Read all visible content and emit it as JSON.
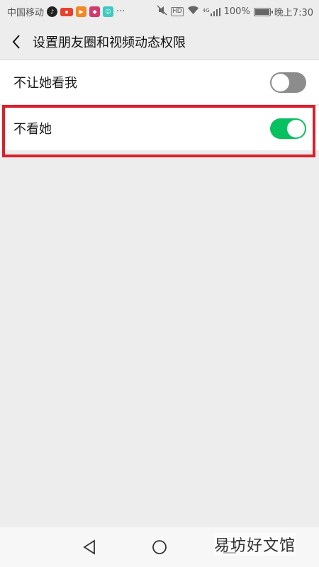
{
  "status_bar": {
    "carrier": "中国移动",
    "icons": [
      "tiktok-icon",
      "app-badge-icon",
      "video-app-icon",
      "app-icon",
      "app-icon",
      "more-dots-icon"
    ],
    "more": "···",
    "right_icons": [
      "mute-icon",
      "hd-icon",
      "wifi-icon",
      "signal-icon"
    ],
    "hd": "HD",
    "net": "4G",
    "battery_text": "100%",
    "battery_level": 1.0,
    "time": "晚上7:30"
  },
  "header": {
    "back_icon": "chevron-left-icon",
    "title": "设置朋友圈和视频动态权限"
  },
  "settings": [
    {
      "label": "不让她看我",
      "enabled": false
    },
    {
      "label": "不看她",
      "enabled": true
    }
  ],
  "colors": {
    "toggle_on": "#07c160",
    "toggle_off": "#8c8c8c",
    "highlight": "#d9202c"
  },
  "nav": {
    "icons": [
      "back-triangle-icon",
      "home-circle-icon",
      "recents-square-icon"
    ]
  },
  "watermark": "易坊好文馆"
}
